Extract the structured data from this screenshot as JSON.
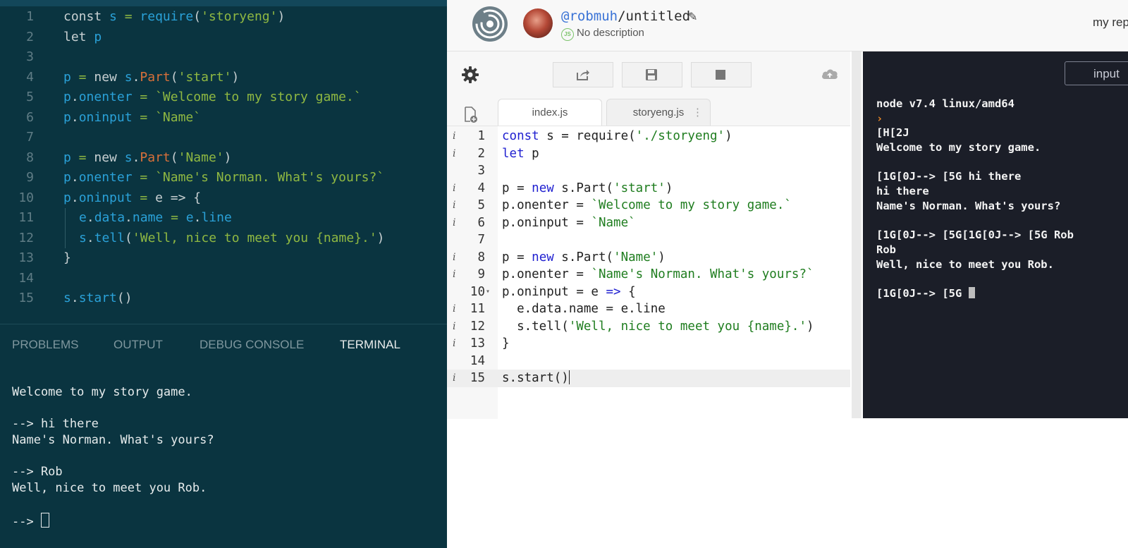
{
  "vscode": {
    "code_lines": [
      {
        "num": "1",
        "tokens": [
          [
            "kw",
            "const "
          ],
          [
            "var",
            "s"
          ],
          [
            "op",
            " = "
          ],
          [
            "var",
            "require"
          ],
          [
            "pl",
            "("
          ],
          [
            "str",
            "'storyeng'"
          ],
          [
            "pl",
            ")"
          ]
        ]
      },
      {
        "num": "2",
        "tokens": [
          [
            "kw",
            "let "
          ],
          [
            "var",
            "p"
          ]
        ]
      },
      {
        "num": "3",
        "tokens": []
      },
      {
        "num": "4",
        "tokens": [
          [
            "var",
            "p"
          ],
          [
            "op",
            " = "
          ],
          [
            "kw",
            "new "
          ],
          [
            "var",
            "s"
          ],
          [
            "pl",
            "."
          ],
          [
            "fn",
            "Part"
          ],
          [
            "pl",
            "("
          ],
          [
            "str",
            "'start'"
          ],
          [
            "pl",
            ")"
          ]
        ]
      },
      {
        "num": "5",
        "tokens": [
          [
            "var",
            "p"
          ],
          [
            "pl",
            "."
          ],
          [
            "var",
            "onenter"
          ],
          [
            "op",
            " = "
          ],
          [
            "str",
            "`Welcome to my story game.`"
          ]
        ]
      },
      {
        "num": "6",
        "tokens": [
          [
            "var",
            "p"
          ],
          [
            "pl",
            "."
          ],
          [
            "var",
            "oninput"
          ],
          [
            "op",
            " = "
          ],
          [
            "str",
            "`Name`"
          ]
        ]
      },
      {
        "num": "7",
        "tokens": []
      },
      {
        "num": "8",
        "tokens": [
          [
            "var",
            "p"
          ],
          [
            "op",
            " = "
          ],
          [
            "kw",
            "new "
          ],
          [
            "var",
            "s"
          ],
          [
            "pl",
            "."
          ],
          [
            "fn",
            "Part"
          ],
          [
            "pl",
            "("
          ],
          [
            "str",
            "'Name'"
          ],
          [
            "pl",
            ")"
          ]
        ]
      },
      {
        "num": "9",
        "tokens": [
          [
            "var",
            "p"
          ],
          [
            "pl",
            "."
          ],
          [
            "var",
            "onenter"
          ],
          [
            "op",
            " = "
          ],
          [
            "str",
            "`Name's Norman. What's yours?`"
          ]
        ]
      },
      {
        "num": "10",
        "tokens": [
          [
            "var",
            "p"
          ],
          [
            "pl",
            "."
          ],
          [
            "var",
            "oninput"
          ],
          [
            "op",
            " = "
          ],
          [
            "pl",
            "e => {"
          ]
        ]
      },
      {
        "num": "11",
        "indent": true,
        "tokens": [
          [
            "var",
            "e"
          ],
          [
            "pl",
            "."
          ],
          [
            "var",
            "data"
          ],
          [
            "pl",
            "."
          ],
          [
            "var",
            "name"
          ],
          [
            "op",
            " = "
          ],
          [
            "var",
            "e"
          ],
          [
            "pl",
            "."
          ],
          [
            "var",
            "line"
          ]
        ]
      },
      {
        "num": "12",
        "indent": true,
        "tokens": [
          [
            "var",
            "s"
          ],
          [
            "pl",
            "."
          ],
          [
            "var",
            "tell"
          ],
          [
            "pl",
            "("
          ],
          [
            "str",
            "'Well, nice to meet you {name}.'"
          ],
          [
            "pl",
            ")"
          ]
        ]
      },
      {
        "num": "13",
        "tokens": [
          [
            "pl",
            "}"
          ]
        ]
      },
      {
        "num": "14",
        "tokens": []
      },
      {
        "num": "15",
        "tokens": [
          [
            "var",
            "s"
          ],
          [
            "pl",
            "."
          ],
          [
            "var",
            "start"
          ],
          [
            "pl",
            "()"
          ]
        ]
      }
    ],
    "panel_tabs": [
      "PROBLEMS",
      "OUTPUT",
      "DEBUG CONSOLE",
      "TERMINAL"
    ],
    "active_panel_tab": "TERMINAL",
    "terminal_lines": [
      "Welcome to my story game.",
      "",
      "--> hi there",
      "Name's Norman. What's yours?",
      "",
      "--> Rob",
      "Well, nice to meet you Rob.",
      "",
      "--> "
    ]
  },
  "replit": {
    "user": "@robmuh",
    "slash": "/",
    "project": "untitled",
    "description": "No description",
    "lang_badge": "JS",
    "account_text": "my rep",
    "file_tabs": [
      "index.js",
      "storyeng.js"
    ],
    "active_file_tab": "index.js",
    "tab_menu_glyph": "⋮",
    "input_button": "input",
    "code_lines": [
      {
        "num": "1",
        "info": true,
        "tokens": [
          [
            "kw",
            "const"
          ],
          [
            "pl",
            " s = require("
          ],
          [
            "str",
            "'./storyeng'"
          ],
          [
            "pl",
            ")"
          ]
        ]
      },
      {
        "num": "2",
        "info": true,
        "tokens": [
          [
            "kw",
            "let"
          ],
          [
            "pl",
            " p"
          ]
        ]
      },
      {
        "num": "3",
        "tokens": []
      },
      {
        "num": "4",
        "info": true,
        "tokens": [
          [
            "pl",
            "p = "
          ],
          [
            "kw",
            "new"
          ],
          [
            "pl",
            " s.Part("
          ],
          [
            "str",
            "'start'"
          ],
          [
            "pl",
            ")"
          ]
        ]
      },
      {
        "num": "5",
        "info": true,
        "tokens": [
          [
            "pl",
            "p.onenter = "
          ],
          [
            "str",
            "`Welcome to my story game.`"
          ]
        ]
      },
      {
        "num": "6",
        "info": true,
        "tokens": [
          [
            "pl",
            "p.oninput = "
          ],
          [
            "str",
            "`Name`"
          ]
        ]
      },
      {
        "num": "7",
        "tokens": []
      },
      {
        "num": "8",
        "info": true,
        "tokens": [
          [
            "pl",
            "p = "
          ],
          [
            "kw",
            "new"
          ],
          [
            "pl",
            " s.Part("
          ],
          [
            "str",
            "'Name'"
          ],
          [
            "pl",
            ")"
          ]
        ]
      },
      {
        "num": "9",
        "info": true,
        "tokens": [
          [
            "pl",
            "p.onenter = "
          ],
          [
            "str",
            "`Name's Norman. What's yours?`"
          ]
        ]
      },
      {
        "num": "10",
        "fold": true,
        "tokens": [
          [
            "pl",
            "p.oninput = e "
          ],
          [
            "kw",
            "=>"
          ],
          [
            "pl",
            " {"
          ]
        ]
      },
      {
        "num": "11",
        "info": true,
        "tokens": [
          [
            "pl",
            "  e.data.name = e.line"
          ]
        ]
      },
      {
        "num": "12",
        "info": true,
        "tokens": [
          [
            "pl",
            "  s.tell("
          ],
          [
            "str",
            "'Well, nice to meet you {name}.'"
          ],
          [
            "pl",
            ")"
          ]
        ]
      },
      {
        "num": "13",
        "info": true,
        "tokens": [
          [
            "pl",
            "}"
          ]
        ]
      },
      {
        "num": "14",
        "tokens": []
      },
      {
        "num": "15",
        "info": true,
        "highlight": true,
        "caret": true,
        "tokens": [
          [
            "pl",
            "s.start()"
          ]
        ]
      }
    ],
    "info_glyph": "i",
    "fold_glyph": "▾",
    "console_lines": [
      "node v7.4 linux/amd64",
      "PROMPT",
      "[H[2J",
      "Welcome to my story game.",
      "",
      "[1G[0J--> [5G hi there",
      "hi there",
      "Name's Norman. What's yours?",
      "",
      "[1G[0J--> [5G[1G[0J--> [5G Rob",
      "Rob",
      "Well, nice to meet you Rob.",
      "",
      "[1G[0J--> [5G "
    ],
    "prompt_glyph": "›"
  }
}
